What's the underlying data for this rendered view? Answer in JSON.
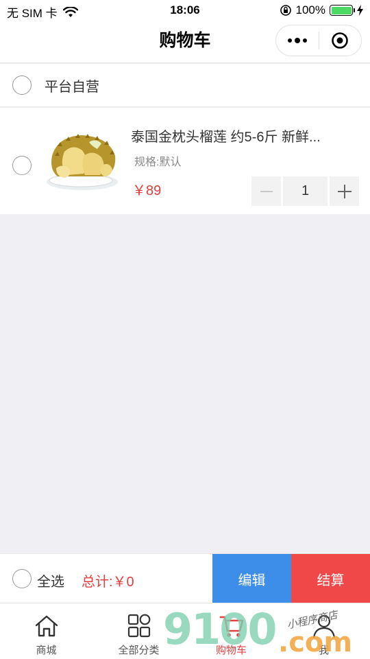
{
  "status_bar": {
    "carrier": "无 SIM 卡",
    "time": "18:06",
    "battery_percent": "100%",
    "battery_level": 1.0
  },
  "nav": {
    "title": "购物车"
  },
  "store": {
    "name": "平台自营",
    "checked": false
  },
  "cart_item": {
    "title": "泰国金枕头榴莲 约5-6斤 新鲜...",
    "spec": "规格:默认",
    "price": "￥89",
    "quantity": "1",
    "image_icon": "durian-image"
  },
  "checkout": {
    "select_all_label": "全选",
    "total": "总计:￥0",
    "edit_label": "编辑",
    "pay_label": "结算"
  },
  "tabs": [
    {
      "label": "商城",
      "icon": "home-icon"
    },
    {
      "label": "全部分类",
      "icon": "grid-icon"
    },
    {
      "label": "购物车",
      "icon": "cart-icon",
      "active": true
    },
    {
      "label": "我",
      "icon": "user-icon"
    }
  ],
  "watermark": {
    "big": "9100",
    "com": ".com",
    "small": "小程序商店"
  },
  "colors": {
    "price_red": "#e23e3e",
    "edit_blue": "#3c8ee8",
    "pay_red": "#f04848",
    "background": "#efeff4"
  }
}
